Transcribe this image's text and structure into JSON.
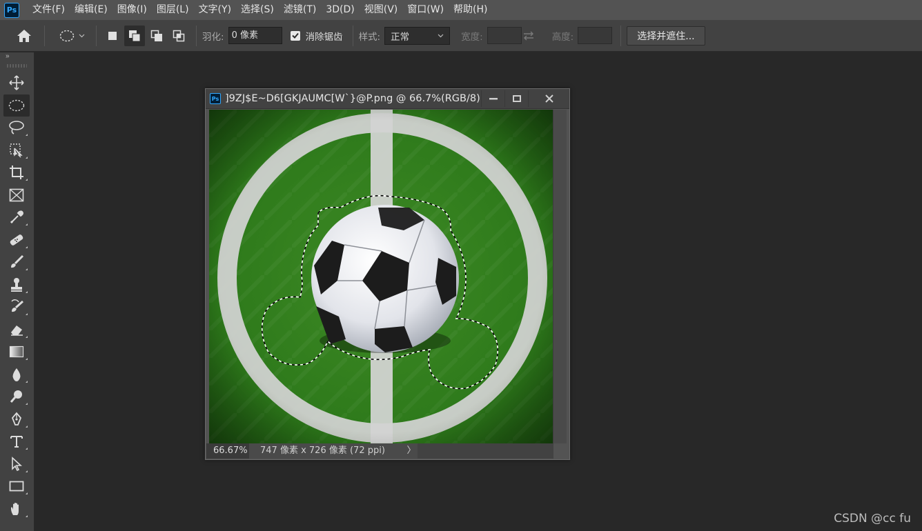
{
  "app": {
    "logo_text": "Ps",
    "accent": "#31a8ff"
  },
  "menu": [
    "文件(F)",
    "编辑(E)",
    "图像(I)",
    "图层(L)",
    "文字(Y)",
    "选择(S)",
    "滤镜(T)",
    "3D(D)",
    "视图(V)",
    "窗口(W)",
    "帮助(H)"
  ],
  "options": {
    "feather_label": "羽化:",
    "feather_value": "0 像素",
    "antialias_label": "消除锯齿",
    "antialias_checked": true,
    "style_label": "样式:",
    "style_value": "正常",
    "width_label": "宽度:",
    "height_label": "高度:",
    "mask_button": "选择并遮住..."
  },
  "toolbar": {
    "collapse_glyph": "»",
    "tools": [
      "move-tool",
      "elliptical-marquee-tool",
      "lasso-tool",
      "object-selection-tool",
      "crop-tool",
      "frame-tool",
      "eyedropper-tool",
      "healing-brush-tool",
      "brush-tool",
      "clone-stamp-tool",
      "history-brush-tool",
      "eraser-tool",
      "gradient-tool",
      "blur-tool",
      "dodge-tool",
      "pen-tool",
      "type-tool",
      "path-selection-tool",
      "rectangle-tool",
      "hand-tool"
    ],
    "active_tool": "elliptical-marquee-tool"
  },
  "document": {
    "title": "]9ZJ$E~D6[GKJAUMC[W`}@P.png @ 66.7%(RGB/8)",
    "zoom": "66.67%",
    "info": "747 像素 x 726 像素 (72 ppi)",
    "status_arrow": "〉"
  },
  "watermark": "CSDN @cc fu"
}
